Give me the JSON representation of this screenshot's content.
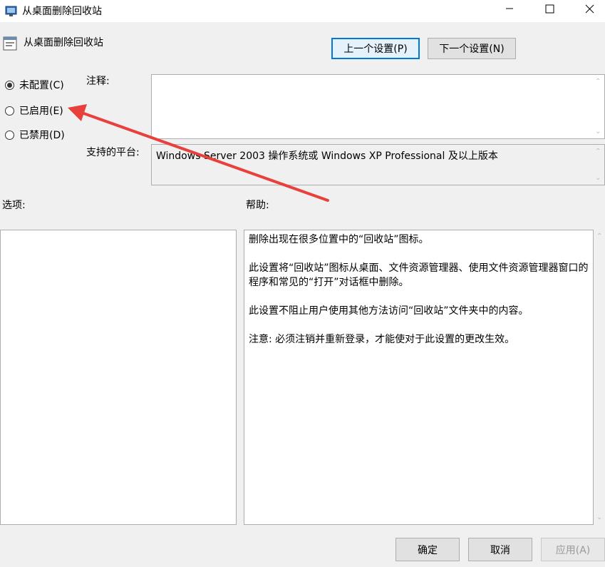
{
  "window": {
    "title": "从桌面删除回收站",
    "controls": {
      "minimize": "—",
      "maximize": "☐",
      "close": "✕"
    }
  },
  "header": {
    "policy_name": "从桌面删除回收站",
    "prev_button": "上一个设置(P)",
    "next_button": "下一个设置(N)"
  },
  "state_options": [
    {
      "label": "未配置(C)",
      "checked": true
    },
    {
      "label": "已启用(E)",
      "checked": false
    },
    {
      "label": "已禁用(D)",
      "checked": false
    }
  ],
  "comment": {
    "label": "注释:",
    "value": ""
  },
  "platform": {
    "label": "支持的平台:",
    "value": "Windows Server 2003 操作系统或 Windows XP Professional 及以上版本"
  },
  "options": {
    "label": "选项:"
  },
  "help": {
    "label": "帮助:",
    "paragraphs": [
      "删除出现在很多位置中的“回收站”图标。",
      "此设置将“回收站”图标从桌面、文件资源管理器、使用文件资源管理器窗口的程序和常见的“打开”对话框中删除。",
      "此设置不阻止用户使用其他方法访问“回收站”文件夹中的内容。",
      "注意: 必须注销并重新登录，才能使对于此设置的更改生效。"
    ]
  },
  "footer": {
    "ok": "确定",
    "cancel": "取消",
    "apply": "应用(A)"
  },
  "colors": {
    "accent": "#0078d7",
    "annotation_arrow": "#e8413b"
  },
  "icons": [
    "policy-icon",
    "minimize-icon",
    "maximize-icon",
    "close-icon",
    "scroll-up-icon",
    "scroll-down-icon"
  ]
}
